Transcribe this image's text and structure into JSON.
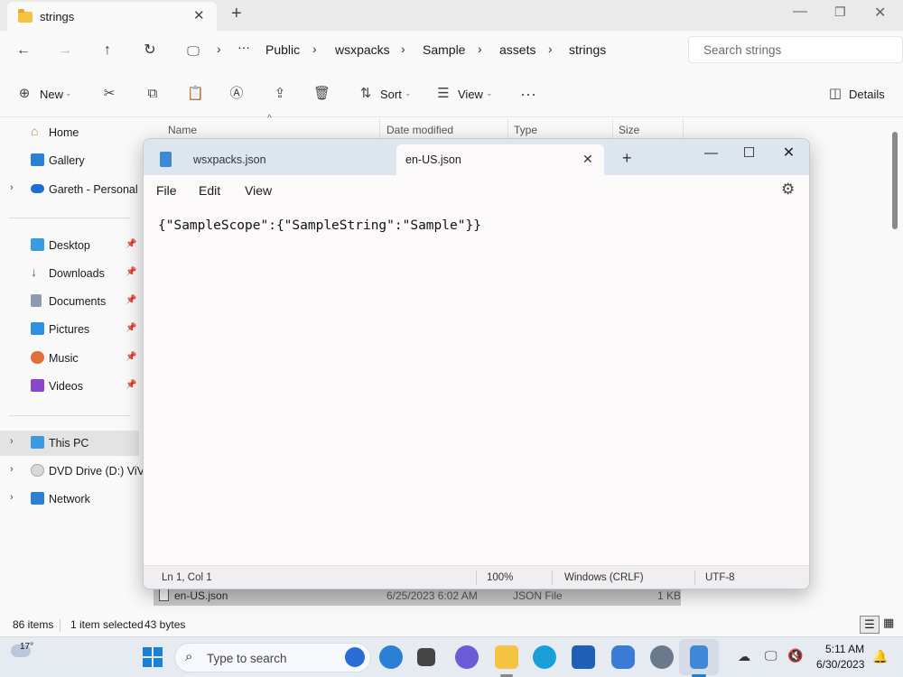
{
  "explorer": {
    "tab_title": "strings",
    "breadcrumb": [
      "Public",
      "wsxpacks",
      "Sample",
      "assets",
      "strings"
    ],
    "search_placeholder": "Search strings",
    "toolbar": {
      "new_label": "New",
      "sort_label": "Sort",
      "view_label": "View",
      "details_label": "Details"
    },
    "sidebar": {
      "home": "Home",
      "gallery": "Gallery",
      "onedrive": "Gareth - Personal",
      "desktop": "Desktop",
      "downloads": "Downloads",
      "documents": "Documents",
      "pictures": "Pictures",
      "music": "Music",
      "videos": "Videos",
      "this_pc": "This PC",
      "dvd": "DVD Drive (D:) ViVe",
      "network": "Network"
    },
    "columns": [
      "Name",
      "Date modified",
      "Type",
      "Size"
    ],
    "file": {
      "name": "en-US.json",
      "date": "6/25/2023 6:02 AM",
      "type": "JSON File",
      "size": "1 KB"
    },
    "status": {
      "items": "86 items",
      "selected": "1 item selected",
      "size": "43 bytes"
    }
  },
  "notepad": {
    "tabs": [
      "wsxpacks.json",
      "en-US.json"
    ],
    "menu": [
      "File",
      "Edit",
      "View"
    ],
    "content": "{\"SampleScope\":{\"SampleString\":\"Sample\"}}",
    "status": {
      "position": "Ln 1, Col 1",
      "zoom": "100%",
      "line_endings": "Windows (CRLF)",
      "encoding": "UTF-8"
    }
  },
  "taskbar": {
    "weather_temp": "17°",
    "search_placeholder": "Type to search",
    "time": "5:11 AM",
    "date": "6/30/2023"
  },
  "colors": {
    "accent": "#0067c0",
    "folder": "#f5c342",
    "selected_row": "#c8c8c8",
    "notepad_tabbar": "#dde6ef"
  }
}
